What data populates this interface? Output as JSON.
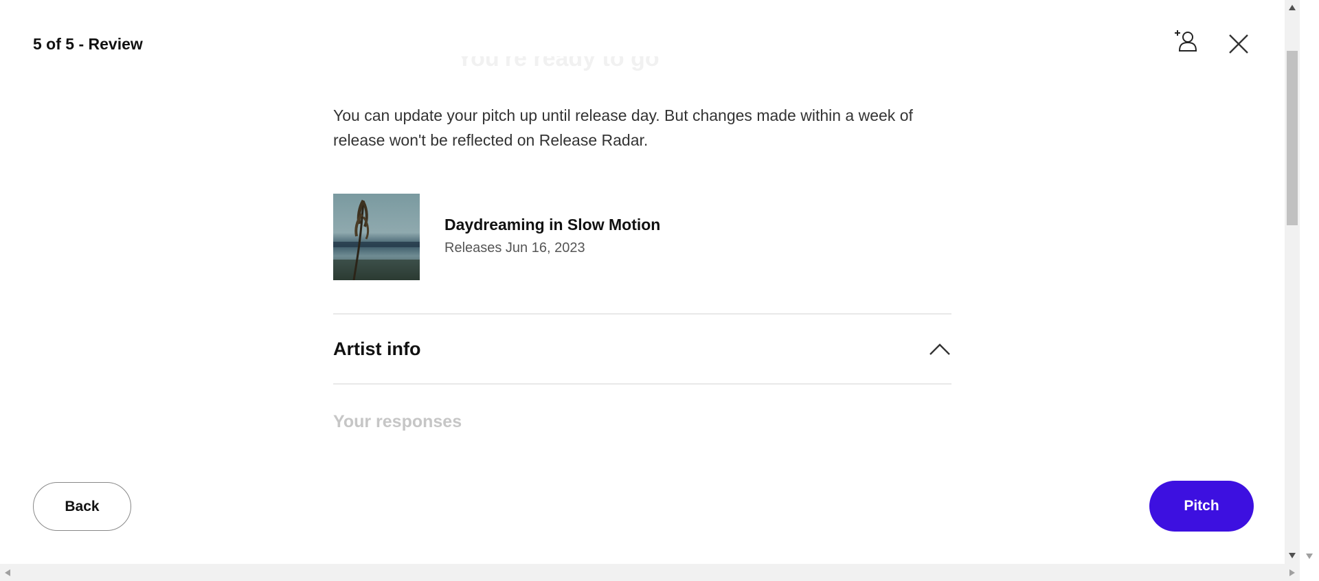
{
  "header": {
    "step_title": "5 of 5 - Review",
    "invite_icon": "add-user-icon",
    "close_icon": "close-icon"
  },
  "main": {
    "faded_heading": "You're ready to go",
    "info_text": "You can update your pitch up until release day. But changes made within a week of release won't be reflected on Release Radar.",
    "release": {
      "name": "Daydreaming in Slow Motion",
      "date": "Releases Jun 16, 2023"
    },
    "accordion": {
      "title": "Artist info",
      "state": "expanded",
      "icon": "chevron-up-icon"
    },
    "faded_subheading": "Your responses"
  },
  "footer": {
    "back_label": "Back",
    "pitch_label": "Pitch"
  },
  "colors": {
    "accent": "#3d10e0",
    "divider": "#e8e8e8",
    "text_secondary": "#555555"
  }
}
